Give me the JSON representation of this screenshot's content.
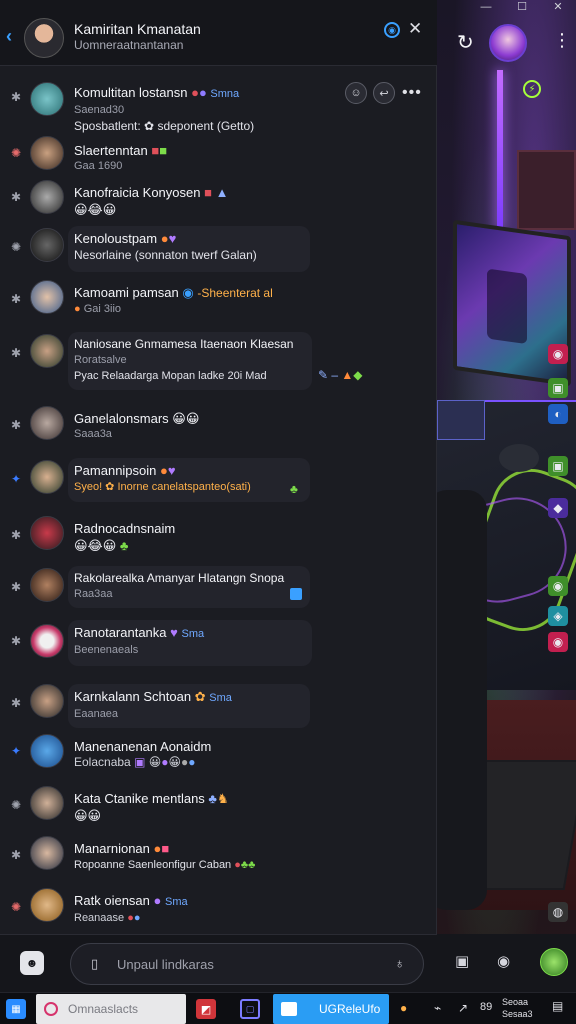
{
  "window": {
    "controls": [
      "—",
      "☐",
      "✕"
    ]
  },
  "header": {
    "title": "Kamiritan Kmanatan",
    "subtitle": "Uomneraatnantanan",
    "pin_icon": "pin-icon",
    "close_icon": "close-icon"
  },
  "messages": [
    {
      "name": "Komultitan lostansn",
      "tag": "Smna",
      "sub": "Saenad30",
      "body": "Sposbatlent: ✿ sdeponent (Getto)",
      "gutter": "✱"
    },
    {
      "name": "Slaertenntan",
      "sub": "Gaa 1690",
      "gutter": "✺"
    },
    {
      "name": "Kanofraicia Konyosen",
      "emoji": "😀😂😀",
      "gutter": "✱"
    },
    {
      "name": "Kenoloustpam",
      "body": "Nesorlaine (sonnaton twerf Galan)",
      "gutter": "✺"
    },
    {
      "name": "Kamoami pamsan",
      "tag": "-Sheenterat al",
      "sub": "Gai 3iio",
      "gutter": "✱"
    },
    {
      "name": "Naniosane Gnmamesa   Itaenaon   Klaesan",
      "sub": "Roratsalve",
      "body": "Pyac Relaadarga Mopan ladke 20i Mad",
      "gutter": "✱"
    },
    {
      "name": "Ganelalonsmars",
      "sub": "Saaa3a",
      "gutter": "✱"
    },
    {
      "name": "Pamannipsoin",
      "body": "Syeo! ✿ Inorne canelatspanteo(sati)",
      "gutter": "✦"
    },
    {
      "name": "Radnocadnsnaim",
      "emoji": "😀😂😀",
      "gutter": "✱"
    },
    {
      "name": "Rakolarealka Amanyar Hlatangn Snopa",
      "sub": "Raa3aa",
      "gutter": "✱"
    },
    {
      "name": "Ranotarantanka",
      "tag": "Sma",
      "sub": "Beenenaeals",
      "gutter": "✱"
    },
    {
      "name": "Karnkalann Schtoan",
      "tag": "Sma",
      "sub": "Eaanaea",
      "gutter": "✱"
    },
    {
      "name": "Manenanenan Aonaidm",
      "sub": "Eolacnaba",
      "gutter": "✦"
    },
    {
      "name": "Kata Ctanike mentlans",
      "emoji": "😀😀",
      "gutter": "✺"
    },
    {
      "name": "Manarnionan",
      "body": "Ropoanne Saenleonfigur Caban",
      "gutter": "✱"
    },
    {
      "name": "Ratk oiensan",
      "tag": "Sma",
      "sub": "Reanaase",
      "gutter": "✺"
    }
  ],
  "composer": {
    "placeholder": "Unpaul lindkaras"
  },
  "taskbar": {
    "search_text": "Omnaaslacts",
    "active_app_text": "UGReleUfo",
    "tray_time": "Seoaa",
    "tray_date": "Sesaa3",
    "tray_number": "89"
  },
  "colors": {
    "accent": "#3aa0ff",
    "panel": "#1b1c22",
    "taskbar_active": "#2a9df4",
    "green": "#7ddc4a"
  }
}
